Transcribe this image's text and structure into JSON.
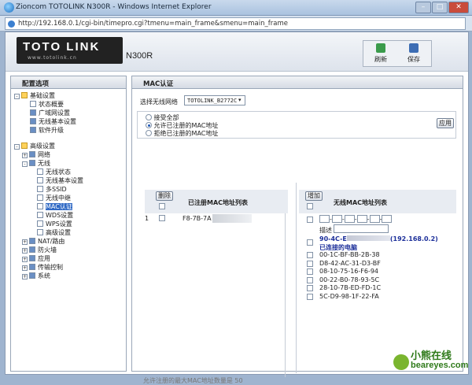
{
  "window": {
    "title": "Zioncom TOTOLINK N300R - Windows Internet Explorer",
    "url": "http://192.168.0.1/cgi-bin/timepro.cgi?tmenu=main_frame&smenu=main_frame"
  },
  "brand": {
    "logo_text": "TOTO LINK",
    "site": "www.totolink.cn",
    "model": "N300R"
  },
  "toolbar": {
    "refresh": "刷新",
    "save": "保存"
  },
  "sidebar": {
    "title": "配置选项",
    "basic": {
      "label": "基础设置",
      "items": [
        "状态概要",
        "广域网设置",
        "无线基本设置",
        "软件升级"
      ]
    },
    "advanced": {
      "label": "高级设置",
      "network": "网络",
      "wireless": "无线",
      "wireless_items": [
        "无线状态",
        "无线基本设置",
        "多SSID",
        "无线中继",
        "MAC认证",
        "WDS设置",
        "WPS设置",
        "高级设置"
      ],
      "other": [
        "NAT/路由",
        "防火墙",
        "应用",
        "传输控制",
        "系统"
      ]
    }
  },
  "main": {
    "title": "MAC认证",
    "select_label": "选择无线网络",
    "select_value": "TOTOLINK_B2772C",
    "options": [
      "接受全部",
      "允许已注册的MAC地址",
      "拒绝已注册的MAC地址"
    ],
    "apply": "应用",
    "left_table": {
      "delete": "删除",
      "header": "已注册MAC地址列表",
      "rows": [
        {
          "index": "1",
          "mac": "F8-7B-7A"
        }
      ]
    },
    "right_table": {
      "add": "增加",
      "header": "无线MAC地址列表",
      "desc_label": "描述",
      "connected_entry": "90-4C-E",
      "connected_ip": "(192.168.0.2)",
      "connected_label": "已连接的电脑",
      "macs": [
        "00-1C-BF-BB-2B-38",
        "D8-42-AC-31-D3-BF",
        "08-10-75-16-F6-94",
        "00-22-B0-78-93-5C",
        "28-10-7B-ED-FD-1C",
        "5C-D9-98-1F-22-FA"
      ]
    },
    "footer_label": "允许注册的最大MAC地址数量是",
    "footer_value": "50"
  },
  "watermark": {
    "cn": "小熊在线",
    "en": "beareyes.com"
  }
}
